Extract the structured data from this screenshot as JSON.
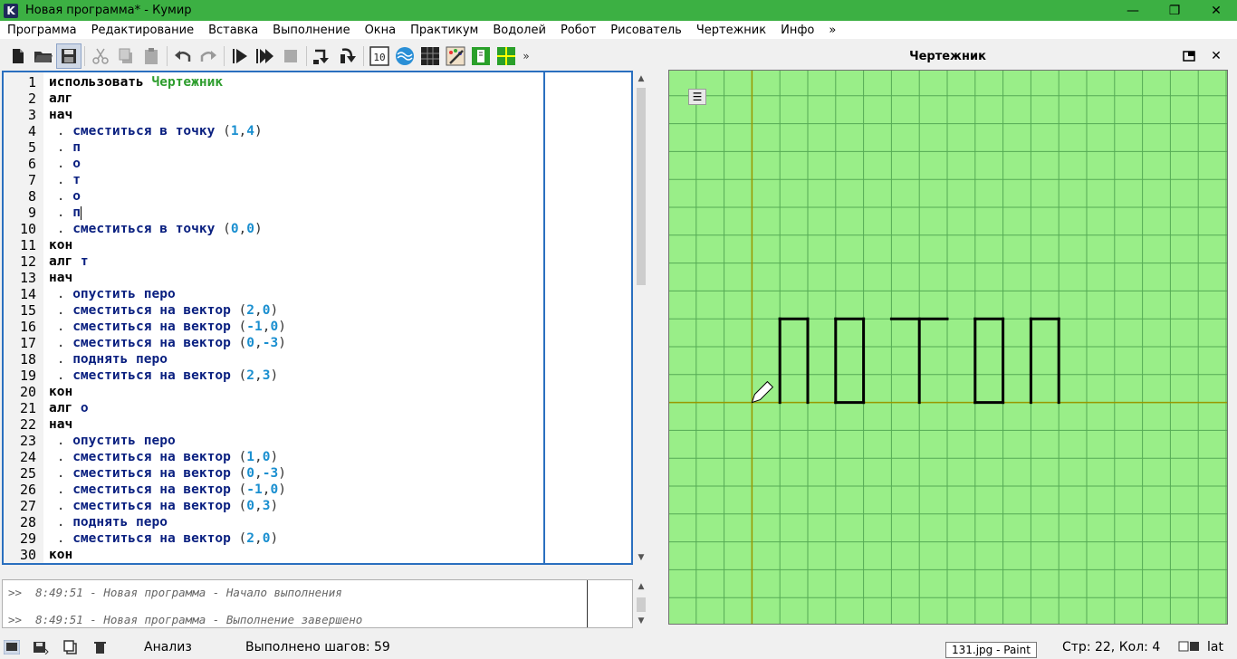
{
  "window": {
    "title": "Новая программа* - Кумир",
    "app_icon_letter": "K",
    "minimize": "—",
    "maximize": "❐",
    "close": "✕"
  },
  "menu": [
    "Программа",
    "Редактирование",
    "Вставка",
    "Выполнение",
    "Окна",
    "Практикум",
    "Водолей",
    "Робот",
    "Рисователь",
    "Чертежник",
    "Инфо",
    "»"
  ],
  "toolbar": {
    "more": "»",
    "number_icon_label": "10"
  },
  "editor": {
    "lines": [
      {
        "n": "1",
        "parts": [
          [
            "kw",
            "использовать "
          ],
          [
            "exec",
            "Чертежник"
          ]
        ]
      },
      {
        "n": "2",
        "parts": [
          [
            "kw",
            "алг"
          ]
        ]
      },
      {
        "n": "3",
        "parts": [
          [
            "kw",
            "нач"
          ]
        ]
      },
      {
        "n": "4",
        "parts": [
          [
            "punc",
            " . "
          ],
          [
            "cmd",
            "сместиться в точку "
          ],
          [
            "punc",
            "("
          ],
          [
            "num",
            "1"
          ],
          [
            "punc",
            ","
          ],
          [
            "num",
            "4"
          ],
          [
            "punc",
            ")"
          ]
        ]
      },
      {
        "n": "5",
        "parts": [
          [
            "punc",
            " . "
          ],
          [
            "cmd",
            "п"
          ]
        ]
      },
      {
        "n": "6",
        "parts": [
          [
            "punc",
            " . "
          ],
          [
            "cmd",
            "о"
          ]
        ]
      },
      {
        "n": "7",
        "parts": [
          [
            "punc",
            " . "
          ],
          [
            "cmd",
            "т"
          ]
        ]
      },
      {
        "n": "8",
        "parts": [
          [
            "punc",
            " . "
          ],
          [
            "cmd",
            "о"
          ]
        ]
      },
      {
        "n": "9",
        "parts": [
          [
            "punc",
            " . "
          ],
          [
            "cmd",
            "п"
          ]
        ],
        "cursor": true
      },
      {
        "n": "10",
        "parts": [
          [
            "punc",
            " . "
          ],
          [
            "cmd",
            "сместиться в точку "
          ],
          [
            "punc",
            "("
          ],
          [
            "num",
            "0"
          ],
          [
            "punc",
            ","
          ],
          [
            "num",
            "0"
          ],
          [
            "punc",
            ")"
          ]
        ]
      },
      {
        "n": "11",
        "parts": [
          [
            "kw",
            "кон"
          ]
        ]
      },
      {
        "n": "12",
        "parts": [
          [
            "kw",
            "алг "
          ],
          [
            "cmd",
            "т"
          ]
        ]
      },
      {
        "n": "13",
        "parts": [
          [
            "kw",
            "нач"
          ]
        ]
      },
      {
        "n": "14",
        "parts": [
          [
            "punc",
            " . "
          ],
          [
            "cmd",
            "опустить перо"
          ]
        ]
      },
      {
        "n": "15",
        "parts": [
          [
            "punc",
            " . "
          ],
          [
            "cmd",
            "сместиться на вектор "
          ],
          [
            "punc",
            "("
          ],
          [
            "num",
            "2"
          ],
          [
            "punc",
            ","
          ],
          [
            "num",
            "0"
          ],
          [
            "punc",
            ")"
          ]
        ]
      },
      {
        "n": "16",
        "parts": [
          [
            "punc",
            " . "
          ],
          [
            "cmd",
            "сместиться на вектор "
          ],
          [
            "punc",
            "("
          ],
          [
            "num",
            "-1"
          ],
          [
            "punc",
            ","
          ],
          [
            "num",
            "0"
          ],
          [
            "punc",
            ")"
          ]
        ]
      },
      {
        "n": "17",
        "parts": [
          [
            "punc",
            " . "
          ],
          [
            "cmd",
            "сместиться на вектор "
          ],
          [
            "punc",
            "("
          ],
          [
            "num",
            "0"
          ],
          [
            "punc",
            ","
          ],
          [
            "num",
            "-3"
          ],
          [
            "punc",
            ")"
          ]
        ]
      },
      {
        "n": "18",
        "parts": [
          [
            "punc",
            " . "
          ],
          [
            "cmd",
            "поднять перо"
          ]
        ]
      },
      {
        "n": "19",
        "parts": [
          [
            "punc",
            " . "
          ],
          [
            "cmd",
            "сместиться на вектор "
          ],
          [
            "punc",
            "("
          ],
          [
            "num",
            "2"
          ],
          [
            "punc",
            ","
          ],
          [
            "num",
            "3"
          ],
          [
            "punc",
            ")"
          ]
        ]
      },
      {
        "n": "20",
        "parts": [
          [
            "kw",
            "кон"
          ]
        ]
      },
      {
        "n": "21",
        "parts": [
          [
            "kw",
            "алг "
          ],
          [
            "cmd",
            "о"
          ]
        ]
      },
      {
        "n": "22",
        "parts": [
          [
            "kw",
            "нач"
          ]
        ]
      },
      {
        "n": "23",
        "parts": [
          [
            "punc",
            " . "
          ],
          [
            "cmd",
            "опустить перо"
          ]
        ]
      },
      {
        "n": "24",
        "parts": [
          [
            "punc",
            " . "
          ],
          [
            "cmd",
            "сместиться на вектор "
          ],
          [
            "punc",
            "("
          ],
          [
            "num",
            "1"
          ],
          [
            "punc",
            ","
          ],
          [
            "num",
            "0"
          ],
          [
            "punc",
            ")"
          ]
        ]
      },
      {
        "n": "25",
        "parts": [
          [
            "punc",
            " . "
          ],
          [
            "cmd",
            "сместиться на вектор "
          ],
          [
            "punc",
            "("
          ],
          [
            "num",
            "0"
          ],
          [
            "punc",
            ","
          ],
          [
            "num",
            "-3"
          ],
          [
            "punc",
            ")"
          ]
        ]
      },
      {
        "n": "26",
        "parts": [
          [
            "punc",
            " . "
          ],
          [
            "cmd",
            "сместиться на вектор "
          ],
          [
            "punc",
            "("
          ],
          [
            "num",
            "-1"
          ],
          [
            "punc",
            ","
          ],
          [
            "num",
            "0"
          ],
          [
            "punc",
            ")"
          ]
        ]
      },
      {
        "n": "27",
        "parts": [
          [
            "punc",
            " . "
          ],
          [
            "cmd",
            "сместиться на вектор "
          ],
          [
            "punc",
            "("
          ],
          [
            "num",
            "0"
          ],
          [
            "punc",
            ","
          ],
          [
            "num",
            "3"
          ],
          [
            "punc",
            ")"
          ]
        ]
      },
      {
        "n": "28",
        "parts": [
          [
            "punc",
            " . "
          ],
          [
            "cmd",
            "поднять перо"
          ]
        ]
      },
      {
        "n": "29",
        "parts": [
          [
            "punc",
            " . "
          ],
          [
            "cmd",
            "сместиться на вектор "
          ],
          [
            "punc",
            "("
          ],
          [
            "num",
            "2"
          ],
          [
            "punc",
            ","
          ],
          [
            "num",
            "0"
          ],
          [
            "punc",
            ")"
          ]
        ]
      },
      {
        "n": "30",
        "parts": [
          [
            "kw",
            "кон"
          ]
        ]
      }
    ]
  },
  "console": {
    "lines": [
      ">>  8:49:51 - Новая программа - Начало выполнения",
      ">>  8:49:51 - Новая программа - Выполнение завершено"
    ]
  },
  "status": {
    "mode": "Анализ",
    "steps": "Выполнено шагов: 59",
    "tooltip": "131.jpg - Paint",
    "position": "Стр: 22, Кол: 4",
    "layout": "lat"
  },
  "drawer": {
    "title": "Чертежник",
    "colors": {
      "background": "#99ee88",
      "grid": "#55aa55",
      "axis": "#999900",
      "pen": "#000000"
    },
    "origin_cell": [
      3,
      12
    ],
    "segments": [
      [
        [
          1,
          0
        ],
        [
          1,
          3
        ]
      ],
      [
        [
          1,
          3
        ],
        [
          2,
          3
        ]
      ],
      [
        [
          2,
          3
        ],
        [
          2,
          0
        ]
      ],
      [
        [
          3,
          0
        ],
        [
          4,
          0
        ]
      ],
      [
        [
          4,
          0
        ],
        [
          4,
          3
        ]
      ],
      [
        [
          4,
          3
        ],
        [
          3,
          3
        ]
      ],
      [
        [
          3,
          3
        ],
        [
          3,
          0
        ]
      ],
      [
        [
          5,
          3
        ],
        [
          7,
          3
        ]
      ],
      [
        [
          6,
          3
        ],
        [
          6,
          0
        ]
      ],
      [
        [
          8,
          0
        ],
        [
          9,
          0
        ]
      ],
      [
        [
          9,
          0
        ],
        [
          9,
          3
        ]
      ],
      [
        [
          9,
          3
        ],
        [
          8,
          3
        ]
      ],
      [
        [
          8,
          3
        ],
        [
          8,
          0
        ]
      ],
      [
        [
          10,
          0
        ],
        [
          10,
          3
        ]
      ],
      [
        [
          10,
          3
        ],
        [
          11,
          3
        ]
      ],
      [
        [
          11,
          3
        ],
        [
          11,
          0
        ]
      ]
    ],
    "pen_position": [
      0,
      0
    ]
  }
}
